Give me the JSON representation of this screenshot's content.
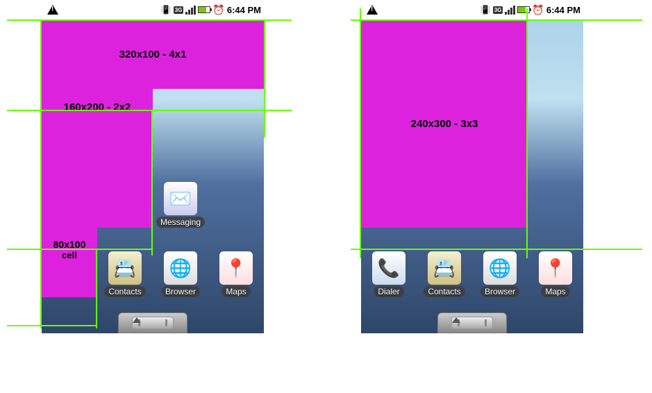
{
  "status": {
    "time": "6:44 PM",
    "net": "3G"
  },
  "widgets": {
    "w4x1": "320x100 - 4x1",
    "w2x2": "160x200 - 2x2",
    "w1x1_a": "80x100",
    "w1x1_b": "cell",
    "w3x3": "240x300 - 3x3"
  },
  "apps": {
    "messaging": "Messaging",
    "contacts": "Contacts",
    "browser": "Browser",
    "maps": "Maps",
    "dialer": "Dialer"
  }
}
